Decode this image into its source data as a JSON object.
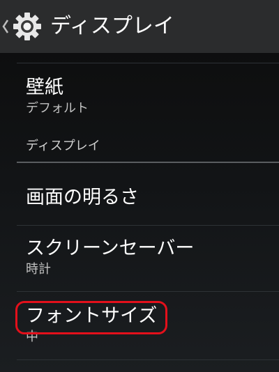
{
  "action_bar": {
    "title": "ディスプレイ",
    "back_icon": "chevron-left-icon",
    "app_icon": "gear-icon"
  },
  "wallpaper": {
    "title": "壁紙",
    "summary": "デフォルト"
  },
  "category": {
    "label": "ディスプレイ"
  },
  "brightness": {
    "title": "画面の明るさ"
  },
  "screensaver": {
    "title": "スクリーンセーバー",
    "summary": "時計"
  },
  "font_size": {
    "title": "フォントサイズ",
    "summary": "中"
  },
  "colors": {
    "action_bar_bg": "#2b2c2d",
    "highlight": "#e3101b",
    "summary_text": "#c2c2c2"
  }
}
